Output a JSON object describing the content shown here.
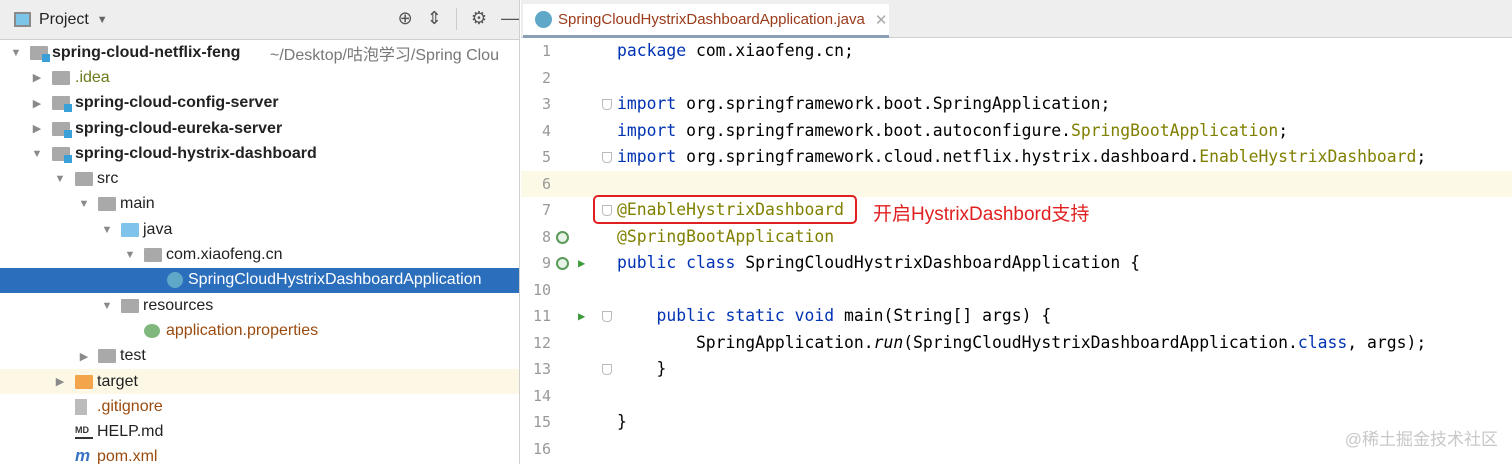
{
  "project_panel": {
    "title": "Project",
    "tree": [
      {
        "depth": 0,
        "arrow": "down",
        "icon": "module",
        "label": "spring-cloud-netflix-feng",
        "bold": true,
        "hint": "~/Desktop/咕泡学习/Spring Clou"
      },
      {
        "depth": 1,
        "arrow": "right",
        "icon": "folder",
        "label": ".idea",
        "color": "olive"
      },
      {
        "depth": 1,
        "arrow": "right",
        "icon": "module",
        "label": "spring-cloud-config-server",
        "bold": true
      },
      {
        "depth": 1,
        "arrow": "right",
        "icon": "module",
        "label": "spring-cloud-eureka-server",
        "bold": true
      },
      {
        "depth": 1,
        "arrow": "down",
        "icon": "module",
        "label": "spring-cloud-hystrix-dashboard",
        "bold": true
      },
      {
        "depth": 2,
        "arrow": "down",
        "icon": "folder",
        "label": "src"
      },
      {
        "depth": 3,
        "arrow": "down",
        "icon": "folder",
        "label": "main"
      },
      {
        "depth": 4,
        "arrow": "down",
        "icon": "folder-blue",
        "label": "java"
      },
      {
        "depth": 5,
        "arrow": "down",
        "icon": "package",
        "label": "com.xiaofeng.cn"
      },
      {
        "depth": 6,
        "arrow": "",
        "icon": "spring-class",
        "label": "SpringCloudHystrixDashboardApplication",
        "selected": true
      },
      {
        "depth": 4,
        "arrow": "down",
        "icon": "resources",
        "label": "resources"
      },
      {
        "depth": 5,
        "arrow": "",
        "icon": "properties",
        "label": "application.properties",
        "color": "brown"
      },
      {
        "depth": 3,
        "arrow": "right",
        "icon": "folder",
        "label": "test"
      },
      {
        "depth": 2,
        "arrow": "right",
        "icon": "folder-orange",
        "label": "target",
        "excluded": true
      },
      {
        "depth": 2,
        "arrow": "",
        "icon": "file",
        "label": ".gitignore",
        "color": "brown"
      },
      {
        "depth": 2,
        "arrow": "",
        "icon": "md",
        "label": "HELP.md"
      },
      {
        "depth": 2,
        "arrow": "",
        "icon": "maven",
        "label": "pom.xml",
        "color": "brown"
      }
    ]
  },
  "editor": {
    "tab_label": "SpringCloudHystrixDashboardApplication.java",
    "lines": [
      {
        "n": "1",
        "tokens": [
          [
            "package",
            "kw"
          ],
          [
            " com.xiaofeng.cn;",
            ""
          ]
        ]
      },
      {
        "n": "2",
        "tokens": []
      },
      {
        "n": "3",
        "fold": true,
        "tokens": [
          [
            "import",
            "kw"
          ],
          [
            " org.springframework.boot.SpringApplication;",
            ""
          ]
        ]
      },
      {
        "n": "4",
        "tokens": [
          [
            "import",
            "kw"
          ],
          [
            " org.springframework.boot.autoconfigure.",
            ""
          ],
          [
            "SpringBootApplication",
            "an"
          ],
          [
            ";",
            ""
          ]
        ]
      },
      {
        "n": "5",
        "fold": true,
        "tokens": [
          [
            "import",
            "kw"
          ],
          [
            " org.springframework.cloud.netflix.hystrix.dashboard.",
            ""
          ],
          [
            "EnableHystrixDashboard",
            "an"
          ],
          [
            ";",
            ""
          ]
        ]
      },
      {
        "n": "6",
        "current": true,
        "tokens": []
      },
      {
        "n": "7",
        "fold": true,
        "tokens": [
          [
            "@EnableHystrixDashboard",
            "an"
          ]
        ]
      },
      {
        "n": "8",
        "bean": true,
        "tokens": [
          [
            "@SpringBootApplication",
            "an"
          ]
        ]
      },
      {
        "n": "9",
        "bean": true,
        "run": true,
        "tokens": [
          [
            "public class",
            "kw"
          ],
          [
            " SpringCloudHystrixDashboardApplication {",
            ""
          ]
        ]
      },
      {
        "n": "10",
        "tokens": []
      },
      {
        "n": "11",
        "run": true,
        "fold": true,
        "tokens": [
          [
            "    ",
            ""
          ],
          [
            "public static void",
            "kw"
          ],
          [
            " main(String[] args) {",
            ""
          ]
        ]
      },
      {
        "n": "12",
        "tokens": [
          [
            "        SpringApplication.",
            ""
          ],
          [
            "run",
            "it"
          ],
          [
            "(SpringCloudHystrixDashboardApplication.",
            ""
          ],
          [
            "class",
            "kw"
          ],
          [
            ", args);",
            ""
          ]
        ]
      },
      {
        "n": "13",
        "fold": true,
        "tokens": [
          [
            "    }",
            ""
          ]
        ]
      },
      {
        "n": "14",
        "tokens": []
      },
      {
        "n": "15",
        "tokens": [
          [
            "}",
            ""
          ]
        ]
      },
      {
        "n": "16",
        "tokens": []
      }
    ],
    "annotation_note": "开启HystrixDashbord支持"
  },
  "watermark": "@稀土掘金技术社区"
}
